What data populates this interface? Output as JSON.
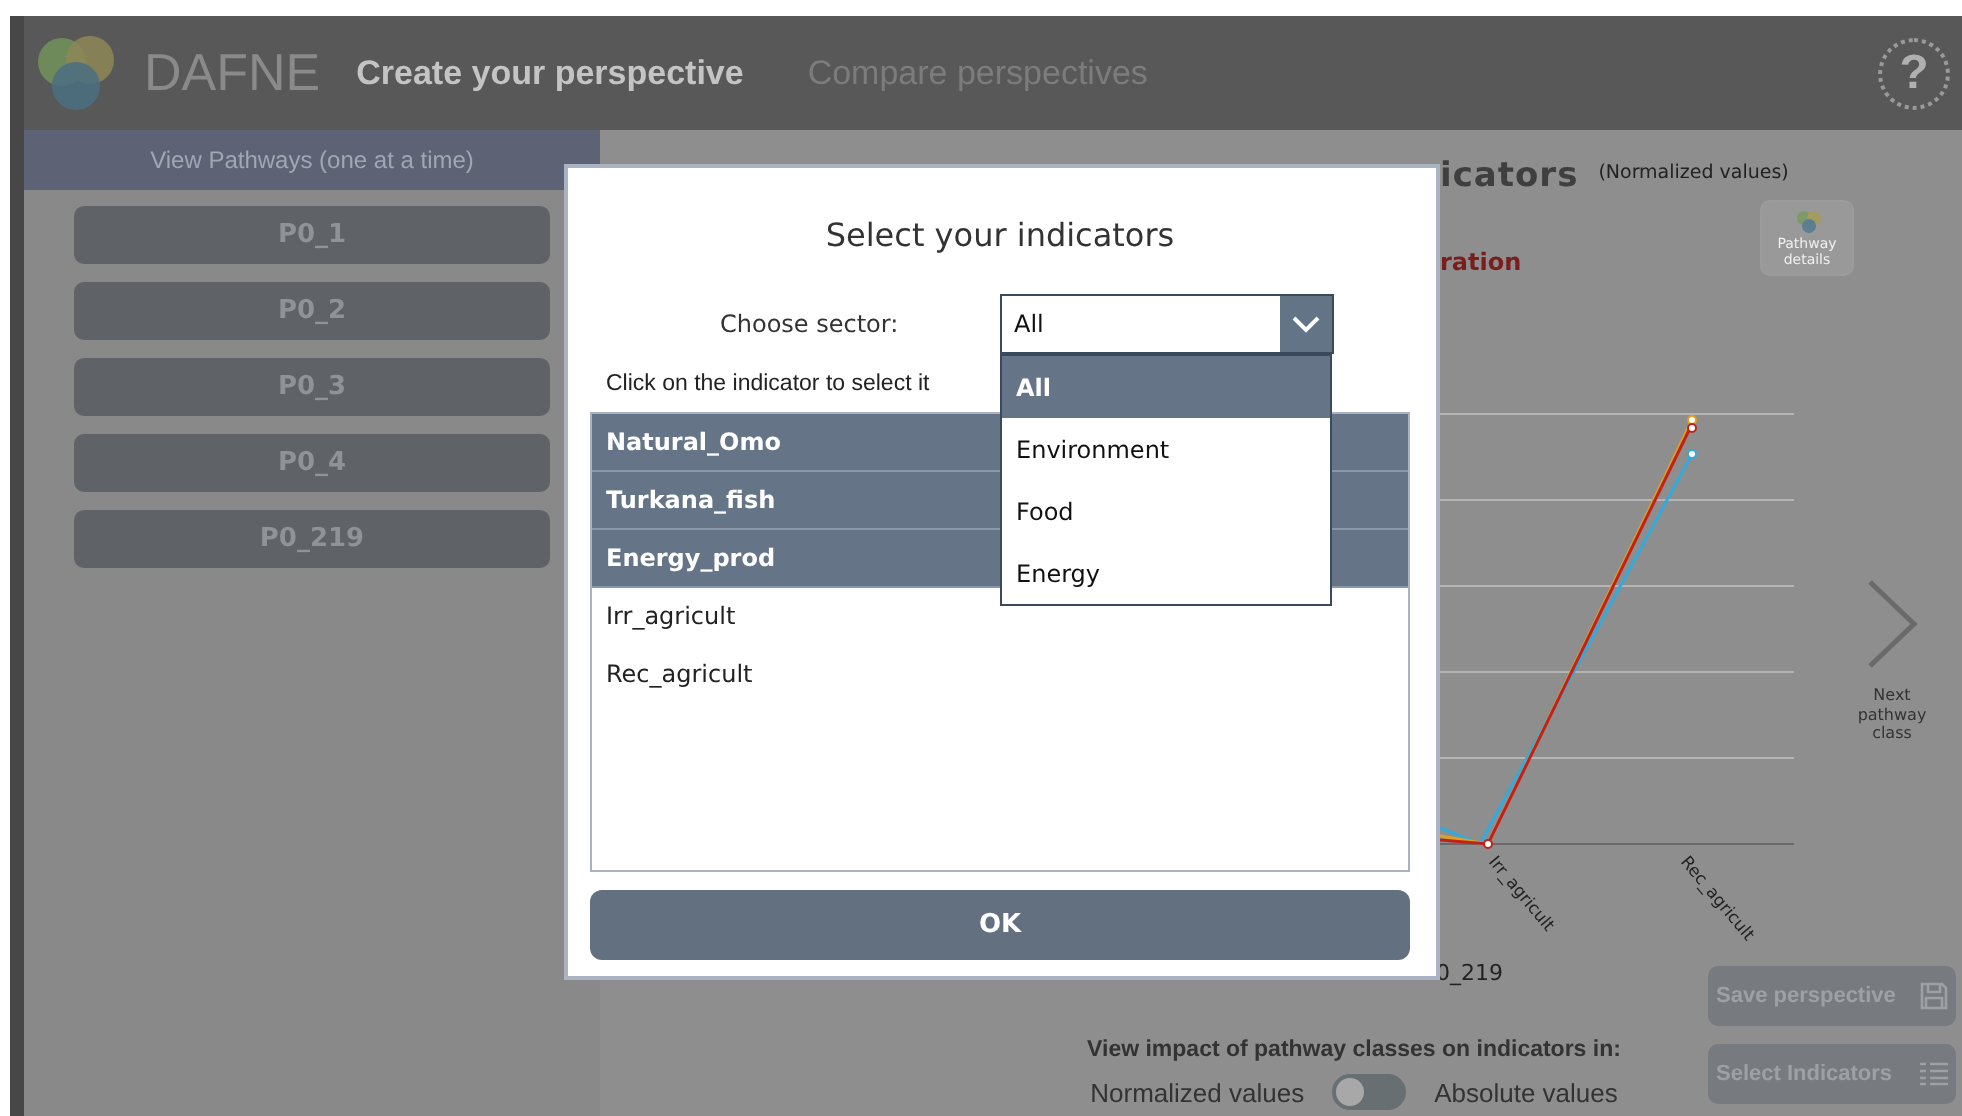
{
  "app": {
    "logo_text": "DAFNE",
    "nav": [
      {
        "label": "Create your perspective",
        "selected": true
      },
      {
        "label": "Compare perspectives",
        "selected": false
      }
    ],
    "help_button": "?"
  },
  "sidebar": {
    "heading": "View Pathways (one at a time)",
    "pathways": [
      "P0_1",
      "P0_2",
      "P0_3",
      "P0_4",
      "P0_219"
    ]
  },
  "main": {
    "title": "icators",
    "title_note": "(Normalized values)",
    "pathway_details": "Pathway details",
    "subtitle": "ration",
    "chart": {
      "axis_labels": [
        "Irr_agricult",
        "Rec_agricult"
      ]
    },
    "next_button": "Next pathway class",
    "legend_label": "0_219",
    "impact_label": "View impact of pathway classes on indicators in:",
    "toggle": {
      "left": "Normalized values",
      "right": "Absolute values",
      "on": false
    },
    "buttons": [
      {
        "label": "Save perspective",
        "kind": "save"
      },
      {
        "label": "Select Indicators",
        "kind": "list"
      }
    ]
  },
  "dialog": {
    "title": "Select your indicators",
    "sector_label": "Choose sector:",
    "sector": {
      "value": "All",
      "expanded": true,
      "options": [
        {
          "label": "All",
          "selected": true
        },
        {
          "label": "Environment",
          "selected": false
        },
        {
          "label": "Food",
          "selected": false
        },
        {
          "label": "Energy",
          "selected": false
        }
      ]
    },
    "instruction": "Click on the indicator to select it",
    "indicators": [
      {
        "label": "Natural_Omo",
        "selected": true
      },
      {
        "label": "Turkana_fish",
        "selected": true
      },
      {
        "label": "Energy_prod",
        "selected": true
      },
      {
        "label": "Irr_agricult",
        "selected": false
      },
      {
        "label": "Rec_agricult",
        "selected": false
      }
    ],
    "ok": "OK"
  }
}
